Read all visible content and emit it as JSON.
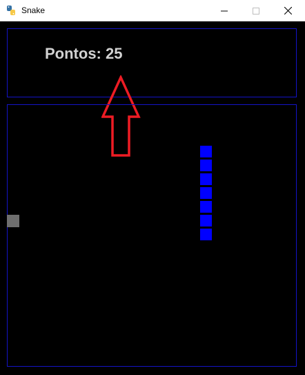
{
  "window": {
    "title": "Snake",
    "icon": "python-icon",
    "controls": [
      "minimize",
      "maximize",
      "close"
    ]
  },
  "score": {
    "label": "Pontos:",
    "value": "25",
    "text": "Pontos: 25"
  },
  "colors": {
    "background": "#000000",
    "border": "#1414c8",
    "snake": "#0000ff",
    "food": "#6e6e6e",
    "score_text": "#d2d2d2",
    "annotation_arrow": "#ed1c24"
  },
  "snake": {
    "segments": 7,
    "direction": "vertical"
  },
  "annotation": {
    "type": "arrow-up",
    "points_to": "score"
  }
}
